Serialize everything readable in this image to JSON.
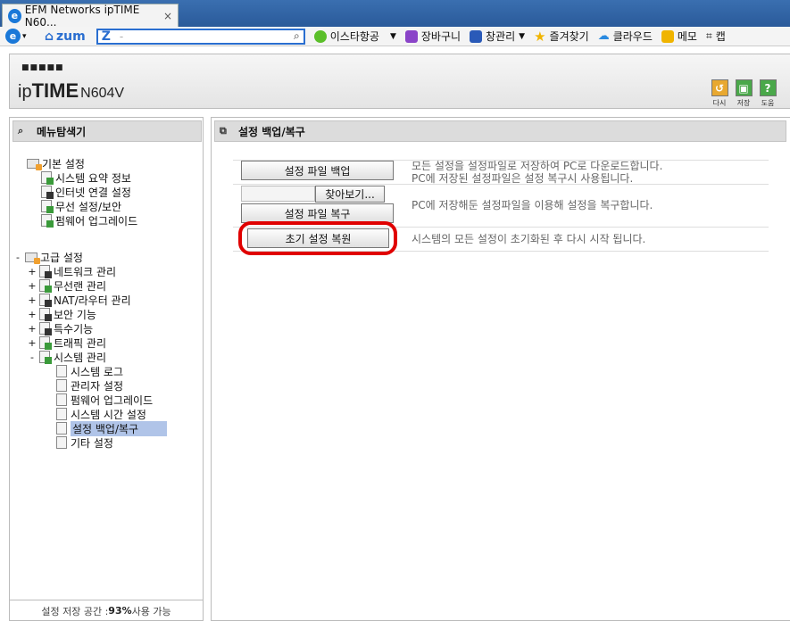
{
  "browser": {
    "tab_title": "EFM Networks ipTIME N60...",
    "tab_close": "×",
    "toolbar": {
      "e_icon": "e",
      "home_label": "zum",
      "search_logo": "Z",
      "search_value": "-",
      "bookmarks": [
        {
          "label": "이스타항공",
          "color": "#5bbf2a"
        },
        {
          "label": "장바구니",
          "color": "#8a44c8"
        },
        {
          "label": "창관리",
          "color": "#2a5ab8"
        },
        {
          "label": "즐겨찾기",
          "color": "#f0b400"
        },
        {
          "label": "클라우드",
          "color": "#2a8ae0"
        },
        {
          "label": "메모",
          "color": "#f0b400"
        },
        {
          "label": "캡",
          "color": "#333333"
        }
      ]
    }
  },
  "header": {
    "logo_dots": "■■■■■",
    "brand_ip": "ip",
    "brand_time": "TIME",
    "model": "N604V",
    "buttons": [
      {
        "label": "다시",
        "glyph": "↺",
        "color": "#e8a830"
      },
      {
        "label": "저장",
        "glyph": "▣",
        "color": "#4aa84a"
      },
      {
        "label": "도움",
        "glyph": "?",
        "color": "#4aa84a"
      }
    ]
  },
  "left_panel": {
    "title": "메뉴탐색기",
    "basic_group": "기본 설정",
    "basic_items": [
      "시스템 요약 정보",
      "인터넷 연결 설정",
      "무선 설정/보안",
      "펌웨어 업그레이드"
    ],
    "advanced_toggle": "-",
    "advanced_group": "고급 설정",
    "advanced_items": [
      {
        "toggle": "+",
        "label": "네트워크 관리"
      },
      {
        "toggle": "+",
        "label": "무선랜 관리"
      },
      {
        "toggle": "+",
        "label": "NAT/라우터 관리"
      },
      {
        "toggle": "+",
        "label": "보안 기능"
      },
      {
        "toggle": "+",
        "label": "특수기능"
      },
      {
        "toggle": "+",
        "label": "트래픽 관리"
      },
      {
        "toggle": "-",
        "label": "시스템 관리"
      }
    ],
    "system_items": [
      "시스템 로그",
      "관리자 설정",
      "펌웨어 업그레이드",
      "시스템 시간 설정",
      "설정 백업/복구",
      "기타 설정"
    ],
    "selected_item": "설정 백업/복구",
    "footer_prefix": "설정 저장 공간 : ",
    "footer_value": "93%",
    "footer_suffix": " 사용 가능"
  },
  "right_panel": {
    "title": "설정 백업/복구",
    "backup_button": "설정 파일 백업",
    "backup_desc_1": "모든 설정을 설정파일로 저장하여 PC로 다운로드합니다.",
    "backup_desc_2": "PC에 저장된 설정파일은 설정 복구시 사용됩니다.",
    "browse_button": "찾아보기...",
    "restore_button": "설정 파일 복구",
    "restore_desc": "PC에 저장해둔 설정파일을 이용해 설정을 복구합니다.",
    "factory_button": "초기 설정 복원",
    "factory_desc": "시스템의 모든 설정이 초기화된 후 다시 시작 됩니다."
  }
}
